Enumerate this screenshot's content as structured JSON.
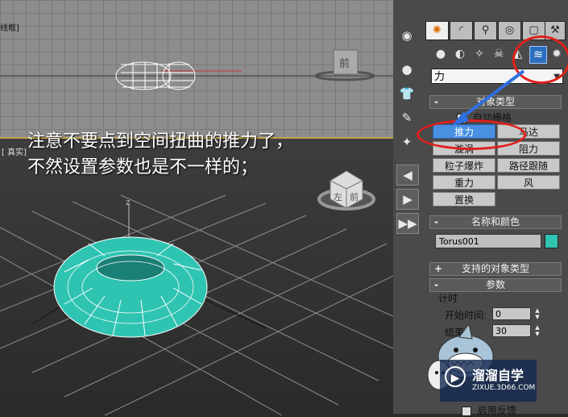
{
  "viewport_top": {
    "label": "线框]"
  },
  "viewport_bottom": {
    "label": "[ 真实]"
  },
  "annotation": {
    "line1": "注意不要点到空间扭曲的推力了，",
    "line2": "不然设置参数也是不一样的；"
  },
  "nav_cube_top": "前",
  "nav_cube_bottom_left": "左",
  "nav_cube_bottom_right": "前",
  "command_panel": {
    "tabs": [
      {
        "name": "create",
        "glyph": "✺",
        "active": true
      },
      {
        "name": "modify",
        "glyph": "◜"
      },
      {
        "name": "hierarchy",
        "glyph": "⚲"
      },
      {
        "name": "motion",
        "glyph": "◎"
      },
      {
        "name": "display",
        "glyph": "▢"
      },
      {
        "name": "utilities",
        "glyph": "⚒"
      }
    ],
    "category_dropdown": "力",
    "object_type": {
      "title": "对象类型",
      "autogrid": "自动栅格",
      "buttons": [
        "推力",
        "马达",
        "漩涡",
        "阻力",
        "粒子爆炸",
        "路径跟随",
        "重力",
        "风",
        "置换"
      ]
    },
    "name_color": {
      "title": "名称和颜色",
      "name_value": "Torus001",
      "color": "#2fc4b2"
    },
    "supported_types": {
      "title": "支持的对象类型"
    },
    "params": {
      "title": "参数",
      "timing": "计时",
      "start_time_label": "开始时间:",
      "start_time_value": "0",
      "end_time_label": "结束",
      "end_time_value": "30",
      "enable_feedback": "启用反馈"
    }
  },
  "watermark": {
    "title": "溜溜自学",
    "url": "ZIXUE.3D66.COM"
  },
  "colors": {
    "highlight_red": "#e0201b",
    "active_blue": "#4a90e2",
    "torus": "#2fc4b2"
  }
}
